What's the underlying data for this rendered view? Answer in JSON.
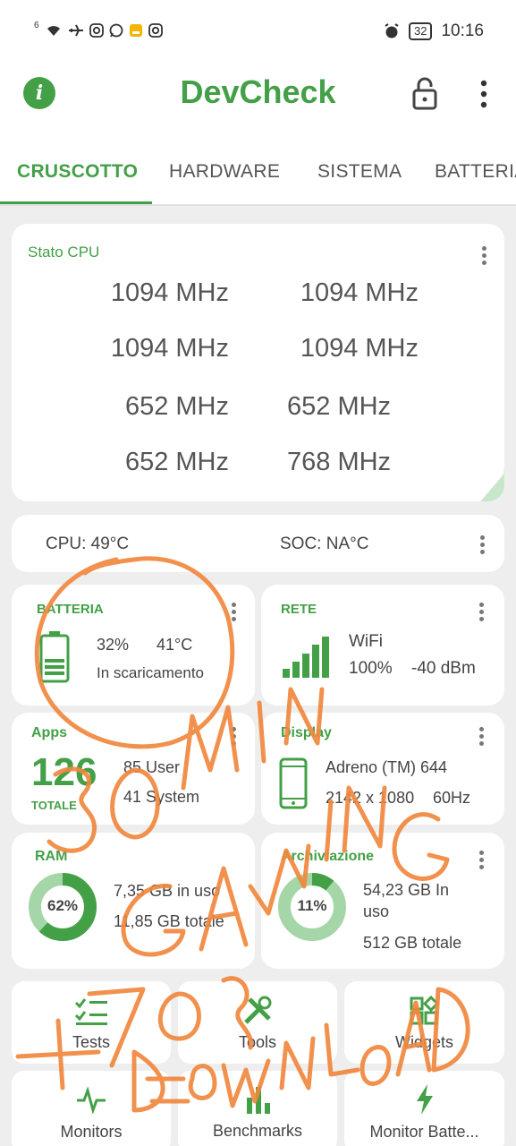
{
  "status_bar": {
    "network": "6",
    "icons": [
      "wifi-icon",
      "airplane-icon",
      "instagram-icon",
      "whatsapp-icon",
      "app-icon",
      "instagram-icon"
    ],
    "battery": "32",
    "time": "10:16"
  },
  "app_bar": {
    "title": "DevCheck",
    "info_glyph": "i"
  },
  "tabs": [
    {
      "label": "CRUSCOTTO",
      "active": true
    },
    {
      "label": "HARDWARE",
      "active": false
    },
    {
      "label": "SISTEMA",
      "active": false
    },
    {
      "label": "BATTERIA",
      "active": false
    }
  ],
  "cpu_card": {
    "title": "Stato CPU",
    "cores": [
      "1094 MHz",
      "1094 MHz",
      "1094 MHz",
      "1094 MHz",
      "652 MHz",
      "652 MHz",
      "652 MHz",
      "768 MHz"
    ]
  },
  "temps": {
    "cpu": "CPU: 49°C",
    "soc": "SOC: NA°C"
  },
  "battery_card": {
    "title": "BATTERIA",
    "percent": "32%",
    "temp": "41°C",
    "status": "In scaricamento",
    "level": 0.32
  },
  "network_card": {
    "title": "RETE",
    "type": "WiFi",
    "signal": "100%",
    "dbm": "-40 dBm"
  },
  "apps_card": {
    "title": "Apps",
    "total": "126",
    "total_label": "TOTALE",
    "user": "85 User",
    "system": "41 System"
  },
  "display_card": {
    "title": "Display",
    "gpu": "Adreno (TM) 644",
    "resolution": "2142 x 1080",
    "refresh": "60Hz"
  },
  "ram_card": {
    "title": "RAM",
    "percent": "62%",
    "percent_value": 62,
    "used": "7,35 GB in uso",
    "total": "11,85 GB totale"
  },
  "storage_card": {
    "title": "Archiviazione",
    "percent": "11%",
    "percent_value": 11,
    "used_line1": "54,23 GB In",
    "used_line2": "uso",
    "total": "512 GB totale"
  },
  "tools": [
    {
      "label": "Tests",
      "icon": "checklist-icon"
    },
    {
      "label": "Tools",
      "icon": "tools-icon"
    },
    {
      "label": "Widgets",
      "icon": "widgets-icon"
    },
    {
      "label": "Monitors",
      "icon": "pulse-icon"
    },
    {
      "label": "Benchmarks",
      "icon": "bar-chart-icon"
    },
    {
      "label": "Monitor Batte...",
      "icon": "lightning-icon"
    }
  ],
  "colors": {
    "accent": "#43a047",
    "accent_light": "#a5d6a7",
    "scribble": "#f0883e"
  }
}
